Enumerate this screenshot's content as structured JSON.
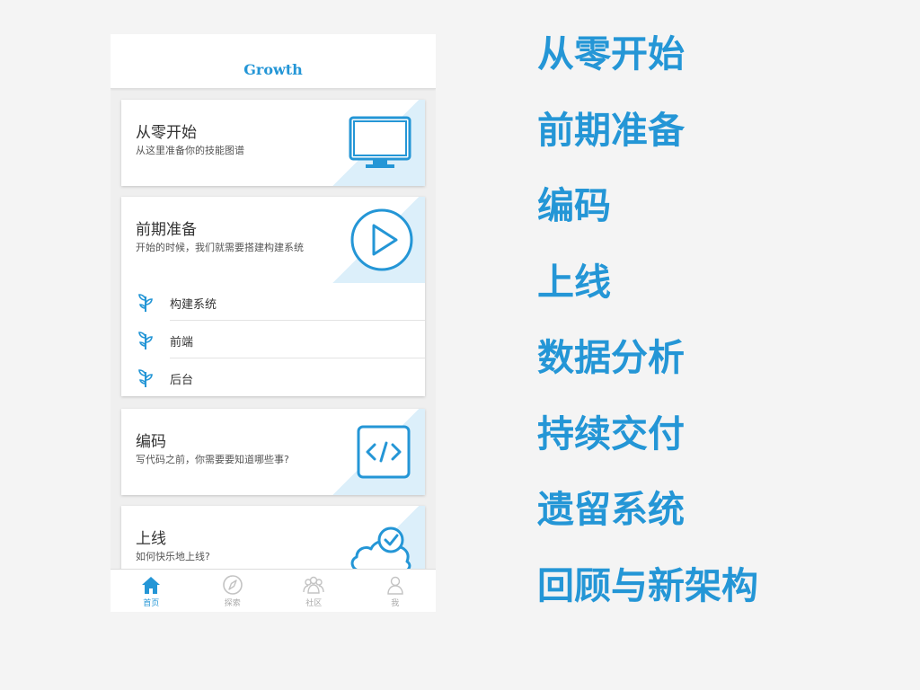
{
  "app": {
    "title": "Growth",
    "accent_color": "#2496d6"
  },
  "cards": [
    {
      "title": "从零开始",
      "subtitle": "从这里准备你的技能图谱",
      "icon": "monitor-icon"
    },
    {
      "title": "前期准备",
      "subtitle": "开始的时候，我们就需要搭建构建系统",
      "icon": "play-circle-icon",
      "subitems": [
        {
          "label": "构建系统",
          "icon": "sprout-icon"
        },
        {
          "label": "前端",
          "icon": "sprout-icon"
        },
        {
          "label": "后台",
          "icon": "sprout-icon"
        }
      ]
    },
    {
      "title": "编码",
      "subtitle": "写代码之前，你需要要知道哪些事?",
      "icon": "code-icon"
    },
    {
      "title": "上线",
      "subtitle": "如何快乐地上线?",
      "icon": "cloud-check-icon"
    }
  ],
  "tabs": [
    {
      "label": "首页",
      "icon": "home-icon",
      "active": true
    },
    {
      "label": "探索",
      "icon": "compass-icon",
      "active": false
    },
    {
      "label": "社区",
      "icon": "people-icon",
      "active": false
    },
    {
      "label": "我",
      "icon": "person-icon",
      "active": false
    }
  ],
  "outline": [
    "从零开始",
    "前期准备",
    "编码",
    "上线",
    "数据分析",
    "持续交付",
    "遗留系统",
    "回顾与新架构"
  ]
}
